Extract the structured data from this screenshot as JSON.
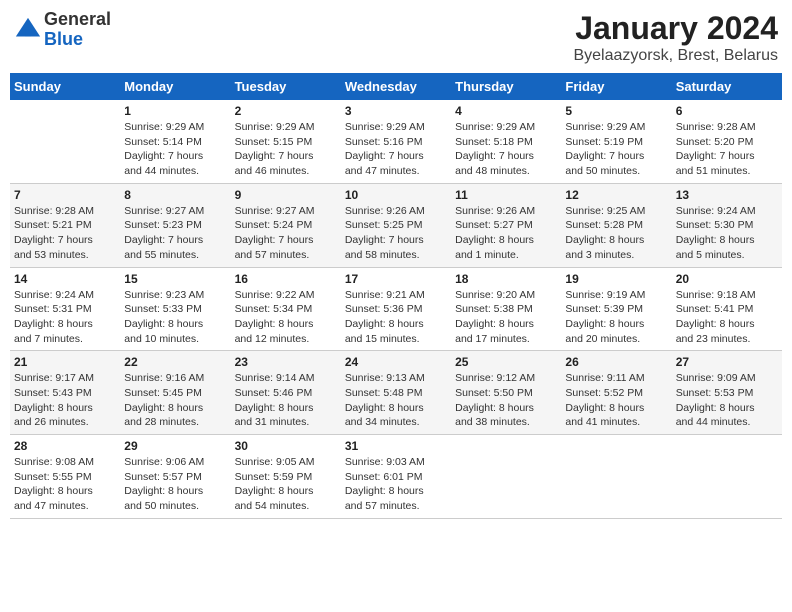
{
  "logo": {
    "general": "General",
    "blue": "Blue"
  },
  "title": "January 2024",
  "subtitle": "Byelaazyorsk, Brest, Belarus",
  "days_of_week": [
    "Sunday",
    "Monday",
    "Tuesday",
    "Wednesday",
    "Thursday",
    "Friday",
    "Saturday"
  ],
  "weeks": [
    [
      {
        "day": "",
        "info": ""
      },
      {
        "day": "1",
        "info": "Sunrise: 9:29 AM\nSunset: 5:14 PM\nDaylight: 7 hours\nand 44 minutes."
      },
      {
        "day": "2",
        "info": "Sunrise: 9:29 AM\nSunset: 5:15 PM\nDaylight: 7 hours\nand 46 minutes."
      },
      {
        "day": "3",
        "info": "Sunrise: 9:29 AM\nSunset: 5:16 PM\nDaylight: 7 hours\nand 47 minutes."
      },
      {
        "day": "4",
        "info": "Sunrise: 9:29 AM\nSunset: 5:18 PM\nDaylight: 7 hours\nand 48 minutes."
      },
      {
        "day": "5",
        "info": "Sunrise: 9:29 AM\nSunset: 5:19 PM\nDaylight: 7 hours\nand 50 minutes."
      },
      {
        "day": "6",
        "info": "Sunrise: 9:28 AM\nSunset: 5:20 PM\nDaylight: 7 hours\nand 51 minutes."
      }
    ],
    [
      {
        "day": "7",
        "info": "Sunrise: 9:28 AM\nSunset: 5:21 PM\nDaylight: 7 hours\nand 53 minutes."
      },
      {
        "day": "8",
        "info": "Sunrise: 9:27 AM\nSunset: 5:23 PM\nDaylight: 7 hours\nand 55 minutes."
      },
      {
        "day": "9",
        "info": "Sunrise: 9:27 AM\nSunset: 5:24 PM\nDaylight: 7 hours\nand 57 minutes."
      },
      {
        "day": "10",
        "info": "Sunrise: 9:26 AM\nSunset: 5:25 PM\nDaylight: 7 hours\nand 58 minutes."
      },
      {
        "day": "11",
        "info": "Sunrise: 9:26 AM\nSunset: 5:27 PM\nDaylight: 8 hours\nand 1 minute."
      },
      {
        "day": "12",
        "info": "Sunrise: 9:25 AM\nSunset: 5:28 PM\nDaylight: 8 hours\nand 3 minutes."
      },
      {
        "day": "13",
        "info": "Sunrise: 9:24 AM\nSunset: 5:30 PM\nDaylight: 8 hours\nand 5 minutes."
      }
    ],
    [
      {
        "day": "14",
        "info": "Sunrise: 9:24 AM\nSunset: 5:31 PM\nDaylight: 8 hours\nand 7 minutes."
      },
      {
        "day": "15",
        "info": "Sunrise: 9:23 AM\nSunset: 5:33 PM\nDaylight: 8 hours\nand 10 minutes."
      },
      {
        "day": "16",
        "info": "Sunrise: 9:22 AM\nSunset: 5:34 PM\nDaylight: 8 hours\nand 12 minutes."
      },
      {
        "day": "17",
        "info": "Sunrise: 9:21 AM\nSunset: 5:36 PM\nDaylight: 8 hours\nand 15 minutes."
      },
      {
        "day": "18",
        "info": "Sunrise: 9:20 AM\nSunset: 5:38 PM\nDaylight: 8 hours\nand 17 minutes."
      },
      {
        "day": "19",
        "info": "Sunrise: 9:19 AM\nSunset: 5:39 PM\nDaylight: 8 hours\nand 20 minutes."
      },
      {
        "day": "20",
        "info": "Sunrise: 9:18 AM\nSunset: 5:41 PM\nDaylight: 8 hours\nand 23 minutes."
      }
    ],
    [
      {
        "day": "21",
        "info": "Sunrise: 9:17 AM\nSunset: 5:43 PM\nDaylight: 8 hours\nand 26 minutes."
      },
      {
        "day": "22",
        "info": "Sunrise: 9:16 AM\nSunset: 5:45 PM\nDaylight: 8 hours\nand 28 minutes."
      },
      {
        "day": "23",
        "info": "Sunrise: 9:14 AM\nSunset: 5:46 PM\nDaylight: 8 hours\nand 31 minutes."
      },
      {
        "day": "24",
        "info": "Sunrise: 9:13 AM\nSunset: 5:48 PM\nDaylight: 8 hours\nand 34 minutes."
      },
      {
        "day": "25",
        "info": "Sunrise: 9:12 AM\nSunset: 5:50 PM\nDaylight: 8 hours\nand 38 minutes."
      },
      {
        "day": "26",
        "info": "Sunrise: 9:11 AM\nSunset: 5:52 PM\nDaylight: 8 hours\nand 41 minutes."
      },
      {
        "day": "27",
        "info": "Sunrise: 9:09 AM\nSunset: 5:53 PM\nDaylight: 8 hours\nand 44 minutes."
      }
    ],
    [
      {
        "day": "28",
        "info": "Sunrise: 9:08 AM\nSunset: 5:55 PM\nDaylight: 8 hours\nand 47 minutes."
      },
      {
        "day": "29",
        "info": "Sunrise: 9:06 AM\nSunset: 5:57 PM\nDaylight: 8 hours\nand 50 minutes."
      },
      {
        "day": "30",
        "info": "Sunrise: 9:05 AM\nSunset: 5:59 PM\nDaylight: 8 hours\nand 54 minutes."
      },
      {
        "day": "31",
        "info": "Sunrise: 9:03 AM\nSunset: 6:01 PM\nDaylight: 8 hours\nand 57 minutes."
      },
      {
        "day": "",
        "info": ""
      },
      {
        "day": "",
        "info": ""
      },
      {
        "day": "",
        "info": ""
      }
    ]
  ]
}
